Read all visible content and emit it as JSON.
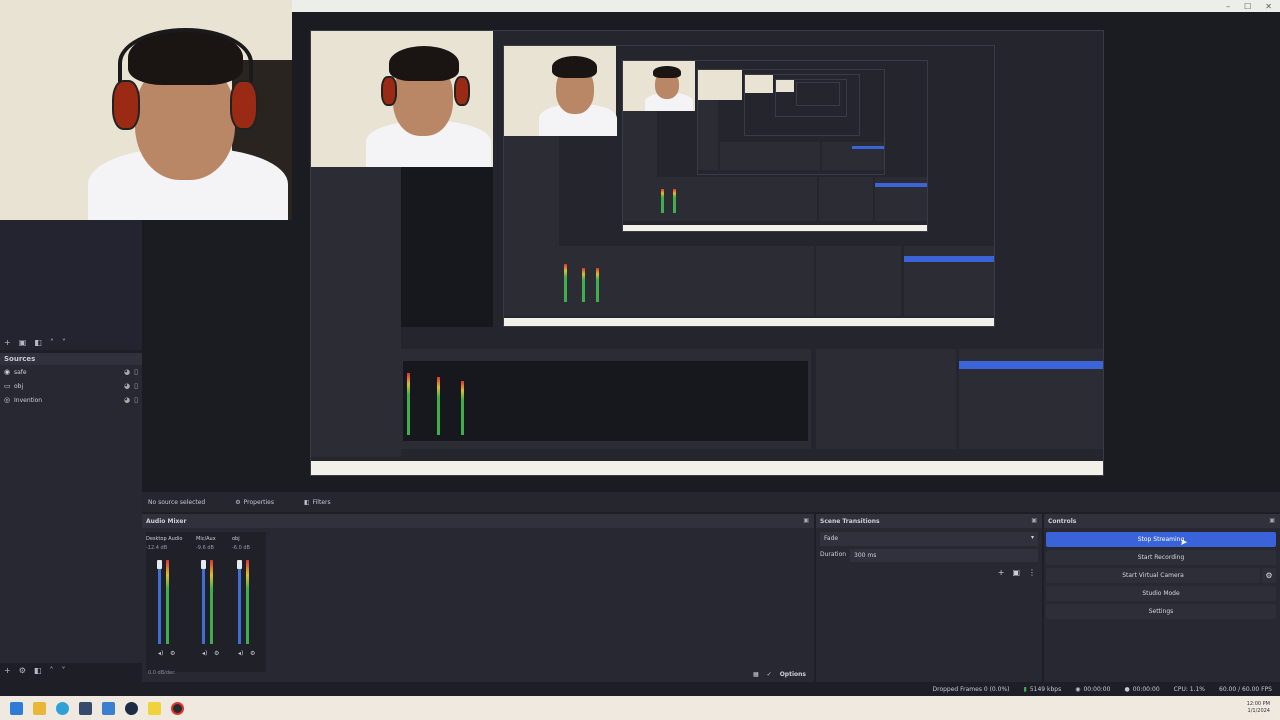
{
  "sources": {
    "title": "Sources",
    "items": [
      {
        "label": "safe",
        "icon": "camera-icon"
      },
      {
        "label": "obj",
        "icon": "display-icon"
      },
      {
        "label": "Invention",
        "icon": "audio-icon"
      }
    ]
  },
  "scene_bar": {
    "no_source": "No source selected",
    "properties": "Properties",
    "filters": "Filters"
  },
  "mixer": {
    "title": "Audio Mixer",
    "channels": [
      {
        "name": "Desktop Audio",
        "db": "-12.4 dB"
      },
      {
        "name": "Mic/Aux",
        "db": "-9.6 dB"
      },
      {
        "name": "obj",
        "db": "-6.0 dB"
      }
    ],
    "options": "Options",
    "footer": "0.0 dB/dec"
  },
  "transitions": {
    "title": "Scene Transitions",
    "type": "Fade",
    "duration_label": "Duration",
    "duration_value": "300 ms"
  },
  "controls": {
    "title": "Controls",
    "buttons": [
      {
        "label": "Stop Streaming",
        "active": true
      },
      {
        "label": "Start Recording",
        "active": false
      },
      {
        "label": "Start Virtual Camera",
        "active": false
      },
      {
        "label": "Studio Mode",
        "active": false
      },
      {
        "label": "Settings",
        "active": false
      }
    ]
  },
  "status": {
    "dropped": "Dropped Frames 0 (0.0%)",
    "bitrate": "5149 kbps",
    "live": "00:00:00",
    "rec": "00:00:00",
    "cpu": "CPU: 1.1%",
    "fps": "60.00 / 60.00 FPS"
  },
  "taskbar": {
    "time": "12:00 PM",
    "date": "1/1/2024"
  }
}
